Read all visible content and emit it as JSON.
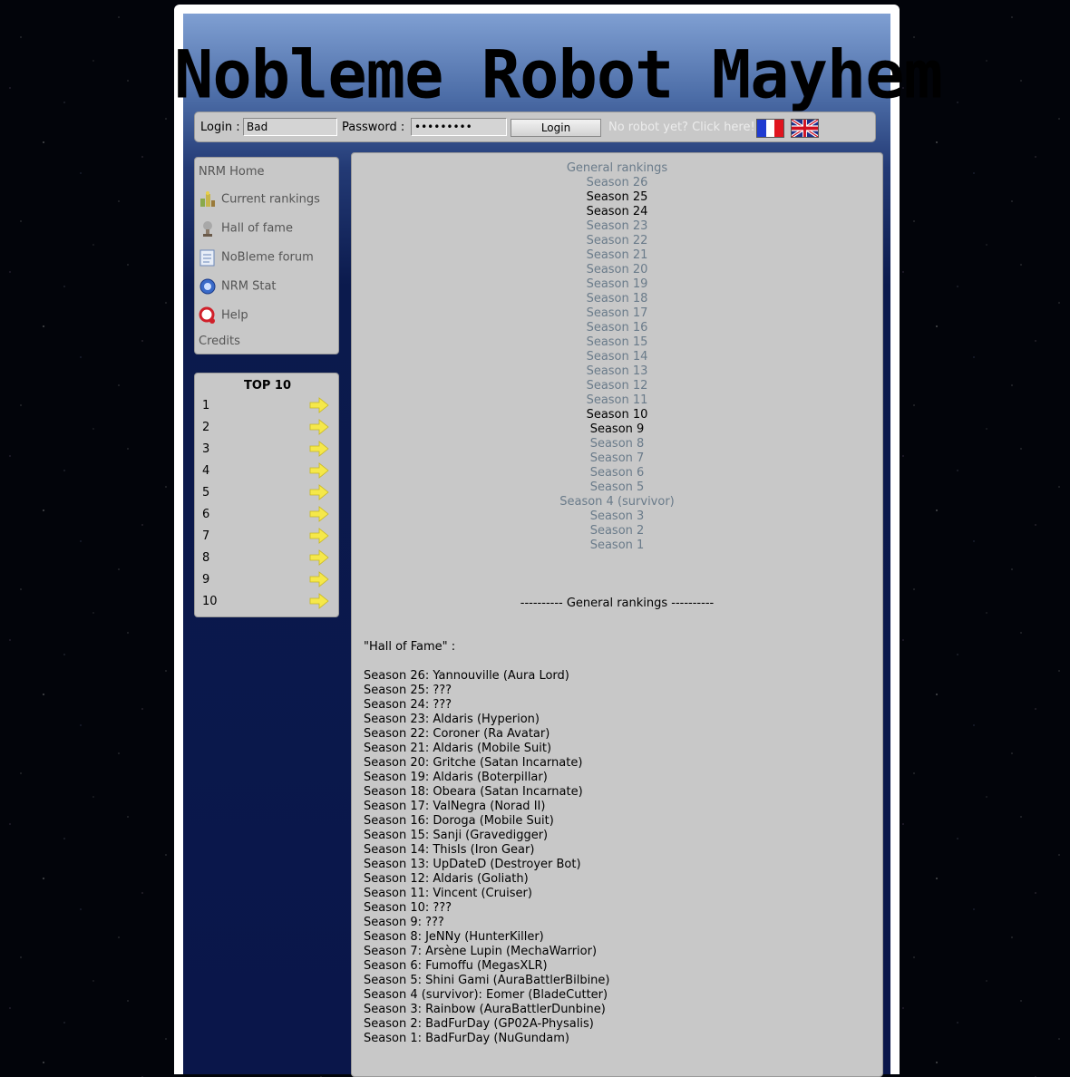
{
  "header": {
    "title": "Nobleme Robot Mayhem"
  },
  "login": {
    "login_label": "Login :",
    "login_value": "Bad",
    "password_label": "Password :",
    "password_value": "abcdefghi",
    "button_label": "Login",
    "register_link": "No robot yet? Click here!",
    "flags": [
      "flag-fr-icon",
      "flag-uk-icon"
    ]
  },
  "menu": {
    "items": [
      {
        "label": "NRM Home",
        "icon": null
      },
      {
        "label": "Current rankings",
        "icon": "rankings-icon"
      },
      {
        "label": "Hall of fame",
        "icon": "trophy-icon"
      },
      {
        "label": "NoBleme forum",
        "icon": "forum-icon"
      },
      {
        "label": "NRM Stat",
        "icon": "stat-icon"
      },
      {
        "label": "Help",
        "icon": "help-icon"
      },
      {
        "label": "Credits",
        "icon": null
      }
    ]
  },
  "top10": {
    "title": "TOP 10",
    "ranks": [
      "1",
      "2",
      "3",
      "4",
      "5",
      "6",
      "7",
      "8",
      "9",
      "10"
    ],
    "arrow_color": "#f5e84a"
  },
  "seasons_nav": {
    "items": [
      {
        "label": "General rankings",
        "current": false
      },
      {
        "label": "Season 26",
        "current": false
      },
      {
        "label": "Season 25",
        "current": true
      },
      {
        "label": "Season 24",
        "current": true
      },
      {
        "label": "Season 23",
        "current": false
      },
      {
        "label": "Season 22",
        "current": false
      },
      {
        "label": "Season 21",
        "current": false
      },
      {
        "label": "Season 20",
        "current": false
      },
      {
        "label": "Season 19",
        "current": false
      },
      {
        "label": "Season 18",
        "current": false
      },
      {
        "label": "Season 17",
        "current": false
      },
      {
        "label": "Season 16",
        "current": false
      },
      {
        "label": "Season 15",
        "current": false
      },
      {
        "label": "Season 14",
        "current": false
      },
      {
        "label": "Season 13",
        "current": false
      },
      {
        "label": "Season 12",
        "current": false
      },
      {
        "label": "Season 11",
        "current": false
      },
      {
        "label": "Season 10",
        "current": true
      },
      {
        "label": "Season 9",
        "current": true
      },
      {
        "label": "Season 8",
        "current": false
      },
      {
        "label": "Season 7",
        "current": false
      },
      {
        "label": "Season 6",
        "current": false
      },
      {
        "label": "Season 5",
        "current": false
      },
      {
        "label": "Season 4 (survivor)",
        "current": false
      },
      {
        "label": "Season 3",
        "current": false
      },
      {
        "label": "Season 2",
        "current": false
      },
      {
        "label": "Season 1",
        "current": false
      }
    ]
  },
  "main": {
    "section_header": "---------- General rankings ----------",
    "hof_title": "\"Hall of Fame\" :",
    "hof_entries": [
      "Season 26: Yannouville (Aura Lord)",
      "Season 25: ???",
      "Season 24: ???",
      "Season 23: Aldaris (Hyperion)",
      "Season 22: Coroner (Ra Avatar)",
      "Season 21: Aldaris (Mobile Suit)",
      "Season 20: Gritche (Satan Incarnate)",
      "Season 19: Aldaris (Boterpillar)",
      "Season 18: Obeara (Satan Incarnate)",
      "Season 17: ValNegra (Norad II)",
      "Season 16: Doroga (Mobile Suit)",
      "Season 15: Sanji (Gravedigger)",
      "Season 14: ThisIs (Iron Gear)",
      "Season 13: UpDateD (Destroyer Bot)",
      "Season 12: Aldaris (Goliath)",
      "Season 11: Vincent (Cruiser)",
      "Season 10: ???",
      "Season 9: ???",
      "Season 8: JeNNy (HunterKiller)",
      "Season 7: Arsène Lupin (MechaWarrior)",
      "Season 6: Fumoffu (MegasXLR)",
      "Season 5: Shini Gami (AuraBattlerBilbine)",
      "Season 4 (survivor): Eomer (BladeCutter)",
      "Season 3: Rainbow (AuraBattlerDunbine)",
      "Season 2: BadFurDay (GP02A-Physalis)",
      "Season 1: BadFurDay (NuGundam)"
    ]
  }
}
